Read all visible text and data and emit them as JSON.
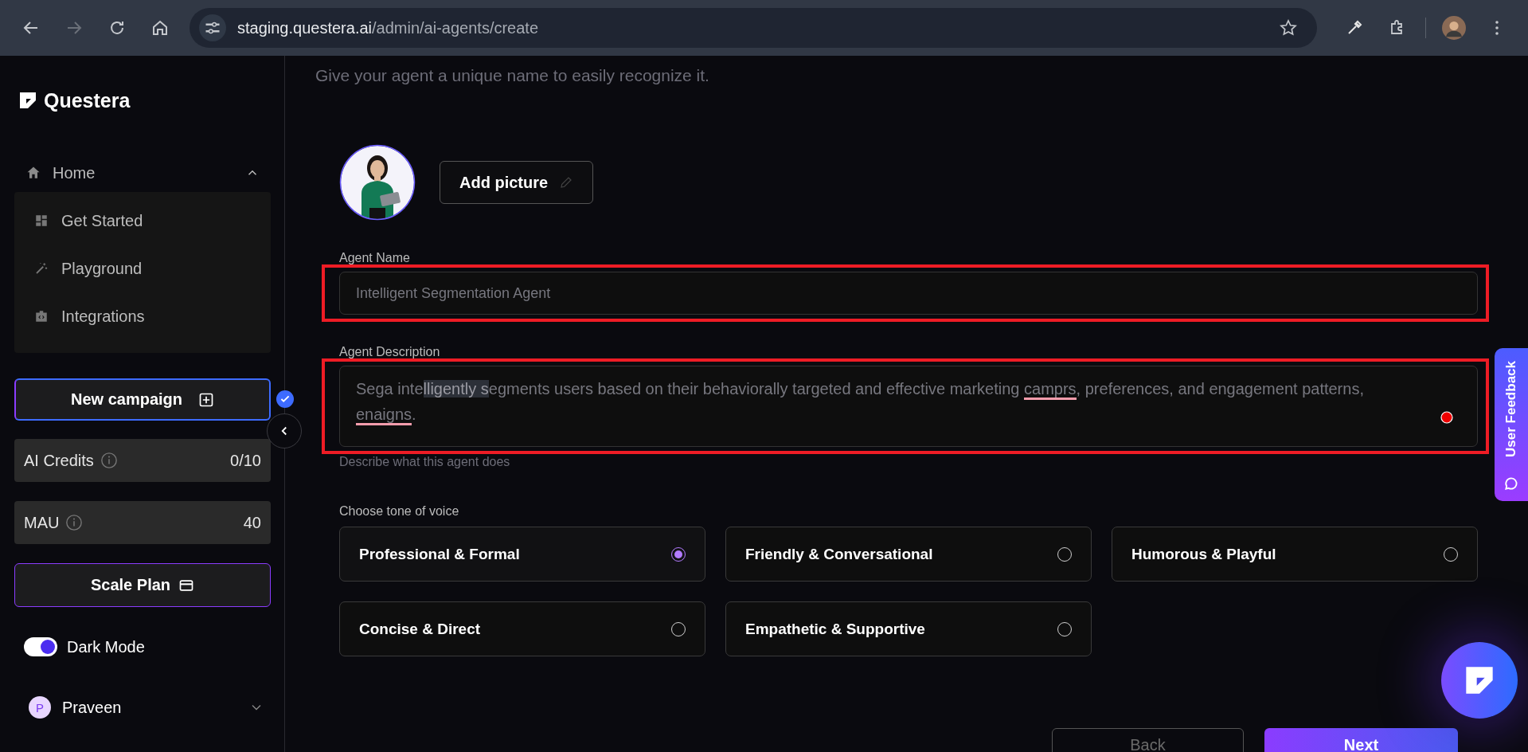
{
  "browser": {
    "url_host": "staging.questera.ai",
    "url_path": "/admin/ai-agents/create"
  },
  "sidebar": {
    "brand": "Questera",
    "nav": {
      "label": "Home",
      "expanded": true,
      "children": [
        {
          "label": "Get Started"
        },
        {
          "label": "Playground"
        },
        {
          "label": "Integrations"
        }
      ]
    },
    "new_campaign": "New campaign",
    "stats": [
      {
        "label": "AI Credits",
        "value": "0/10"
      },
      {
        "label": "MAU",
        "value": "40"
      }
    ],
    "scale_plan": "Scale Plan",
    "dark_mode": {
      "label": "Dark Mode",
      "on": true
    },
    "user": {
      "initial": "P",
      "name": "Praveen"
    }
  },
  "form": {
    "subtitle": "Give your agent a unique name to easily recognize it.",
    "add_picture": "Add picture",
    "agent_name": {
      "label": "Agent Name",
      "value": "Intelligent Segmentation Agent"
    },
    "description": {
      "label": "Agent Description",
      "helper": "Describe what this agent does",
      "segments": [
        {
          "kind": "plain",
          "text": "Sega inte"
        },
        {
          "kind": "highlighted",
          "text": "lligently s"
        },
        {
          "kind": "plain",
          "text": "egments users based on their behaviorally targeted and effective marketing "
        },
        {
          "kind": "misspelled",
          "text": "camprs"
        },
        {
          "kind": "plain",
          "text": ", preferences, and engagement patterns, "
        },
        {
          "kind": "misspelled",
          "text": "enaigns"
        },
        {
          "kind": "plain",
          "text": "."
        }
      ]
    },
    "tone": {
      "label": "Choose tone of voice",
      "options": [
        {
          "label": "Professional & Formal",
          "selected": true
        },
        {
          "label": "Friendly & Conversational",
          "selected": false
        },
        {
          "label": "Humorous & Playful",
          "selected": false
        },
        {
          "label": "Concise & Direct",
          "selected": false
        },
        {
          "label": "Empathetic & Supportive",
          "selected": false
        }
      ]
    },
    "back": "Back",
    "next": "Next"
  },
  "feedback": "User Feedback"
}
